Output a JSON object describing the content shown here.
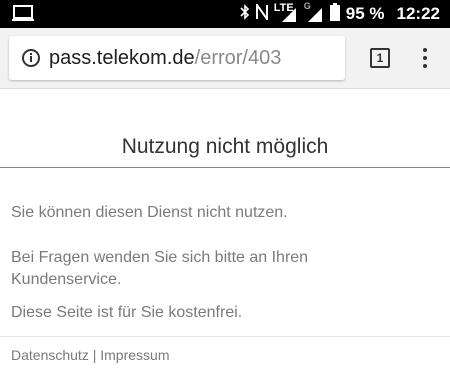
{
  "status_bar": {
    "battery_percent": "95 %",
    "time": "12:22",
    "network_label": "LTE",
    "signal2_label": "G",
    "icons": [
      "screen-cast-icon",
      "bluetooth-icon",
      "nfc-icon",
      "lte-signal-icon",
      "signal-icon",
      "battery-icon"
    ]
  },
  "browser": {
    "url_host": "pass.telekom.de",
    "url_path": "/error/403",
    "tab_count": "1"
  },
  "page": {
    "title": "Nutzung nicht möglich",
    "message1": "Sie können diesen Dienst nicht nutzen.",
    "message2": "Bei Fragen wenden Sie sich bitte an Ihren Kundenservice.",
    "message3": "Diese Seite ist für Sie kostenfrei.",
    "footer_link1": "Datenschutz",
    "footer_separator": " | ",
    "footer_link2": "Impressum"
  }
}
